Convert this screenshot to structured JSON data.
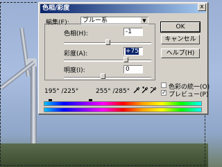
{
  "dialog": {
    "title": "色相/彩度",
    "close_label": "x",
    "edit_label": "編集(E):",
    "edit_value": "ブルー系",
    "hue_label": "色相(H):",
    "hue_value": "-1",
    "saturation_label": "彩度(A):",
    "saturation_value": "+75",
    "lightness_label": "明度(I):",
    "lightness_value": "0",
    "range_left": "195° /225°",
    "range_right": "255° /285°",
    "ok_label": "OK",
    "cancel_label": "キャンセル",
    "help_label": "ヘルプ(H)",
    "colorize_label": "色彩の統一(O)",
    "preview_label": "プレビュー(P)",
    "preview_checked": "✓",
    "colorize_checked": ""
  },
  "colors": {
    "title_start": "#0a246a",
    "title_end": "#a6caf0",
    "dialog_bg": "#d4d0c8"
  }
}
